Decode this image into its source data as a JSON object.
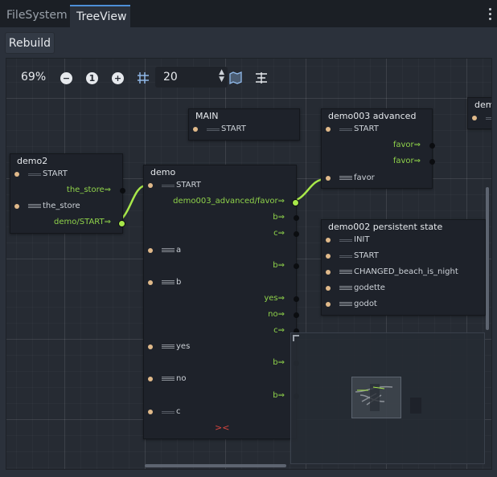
{
  "tabs": [
    {
      "label": "FileSystem",
      "active": false
    },
    {
      "label": "TreeView",
      "active": true
    }
  ],
  "toolbar": {
    "rebuild": "Rebuild",
    "zoom": "69%",
    "reset_label": "1",
    "snap": "20"
  },
  "icons": {
    "zoom_out": "minus-icon",
    "zoom_reset": "one-icon",
    "zoom_in": "plus-icon",
    "grid": "grid-snap-icon",
    "minimap": "minimap-icon",
    "arrange": "arrange-nodes-icon",
    "menu": "kebab-menu-icon"
  },
  "nodes": {
    "main": {
      "title": "MAIN",
      "rows": [
        {
          "text": "START"
        }
      ]
    },
    "demo003": {
      "title": "demo003 advanced",
      "rows": [
        {
          "text": "START"
        },
        {
          "out": "favor⇒"
        },
        {
          "out": "favor⇒"
        },
        {
          "text": "favor"
        }
      ]
    },
    "demo2": {
      "title": "demo2",
      "rows": [
        {
          "text": "START"
        },
        {
          "out": "the_store⇒"
        },
        {
          "text": "the_store"
        },
        {
          "out": "demo/START⇒"
        }
      ]
    },
    "demo": {
      "title": "demo",
      "rows": [
        {
          "text": "START"
        },
        {
          "out": "demo003_advanced/favor⇒"
        },
        {
          "out": "b⇒"
        },
        {
          "out": "c⇒"
        },
        {
          "text": "a"
        },
        {
          "out": "b⇒"
        },
        {
          "text": "b"
        },
        {
          "out": "yes⇒"
        },
        {
          "out": "no⇒"
        },
        {
          "out": "c⇒"
        },
        {
          "text": "yes"
        },
        {
          "out": "b⇒"
        },
        {
          "text": "no"
        },
        {
          "out": "b⇒"
        },
        {
          "text": "c"
        }
      ],
      "close": "><"
    },
    "demo002": {
      "title": "demo002 persistent state",
      "rows": [
        {
          "text": "INIT"
        },
        {
          "text": "START"
        },
        {
          "text": "CHANGED_beach_is_night"
        },
        {
          "text": "godette"
        },
        {
          "text": "godot"
        }
      ]
    },
    "demo_partial": {
      "title": "demo"
    }
  },
  "colors": {
    "accent": "#4d8fd8",
    "wire_active": "#a8e84a",
    "port_in": "#e0b98a",
    "port_out_label": "#8fd24a"
  }
}
